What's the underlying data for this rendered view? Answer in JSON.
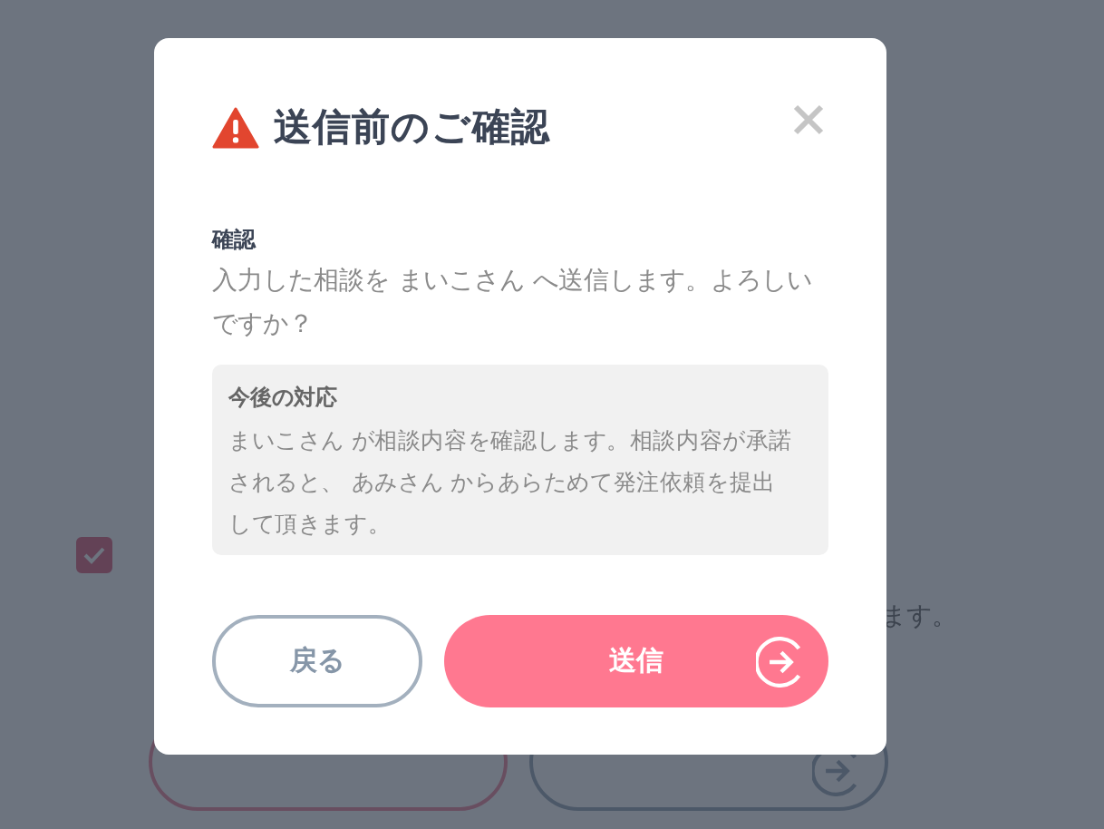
{
  "background_page": {
    "agreement_checkbox": {
      "checked": true
    },
    "note_text": "ます。",
    "buttons": [
      {
        "kind": "back"
      },
      {
        "kind": "next"
      }
    ]
  },
  "modal": {
    "title": "送信前のご確認",
    "confirm_label": "確認",
    "confirm_text": "入力した相談を まいこさん へ送信します。よろしいですか？",
    "next_steps": {
      "title": "今後の対応",
      "text": "まいこさん が相談内容を確認します。相談内容が承諾されると、 あみさん からあらためて発注依頼を提出して頂きます。"
    },
    "buttons": [
      {
        "label": "戻る",
        "kind": "back"
      },
      {
        "label": "送信",
        "kind": "submit"
      }
    ]
  }
}
